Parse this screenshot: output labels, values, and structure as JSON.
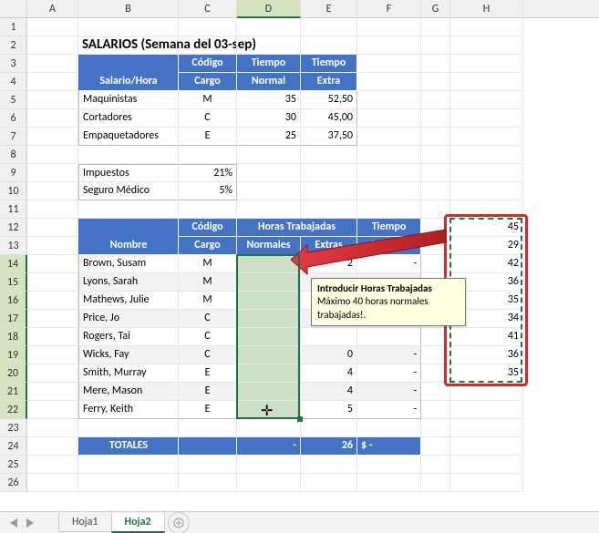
{
  "columns": [
    "A",
    "B",
    "C",
    "D",
    "E",
    "F",
    "G",
    "H"
  ],
  "rows": [
    "1",
    "2",
    "3",
    "4",
    "5",
    "6",
    "7",
    "8",
    "9",
    "10",
    "11",
    "12",
    "13",
    "14",
    "15",
    "16",
    "17",
    "18",
    "19",
    "20",
    "21",
    "22",
    "23",
    "24",
    "25",
    "26"
  ],
  "colWidths": {
    "A": 56,
    "B": 110,
    "C": 64,
    "D": 70,
    "E": 62,
    "F": 70,
    "G": 32,
    "H": 80
  },
  "title": "SALARIOS (Semana del 03-sep)",
  "table1": {
    "headers": {
      "salario_hora": "Salario/Hora",
      "codigo": "Código",
      "cargo": "Cargo",
      "tiempo": "Tiempo",
      "normal": "Normal",
      "extra": "Extra"
    },
    "rows": [
      {
        "nombre": "Maquinistas",
        "codigo": "M",
        "normal": "35",
        "extra": "52,50"
      },
      {
        "nombre": "Cortadores",
        "codigo": "C",
        "normal": "30",
        "extra": "45,00"
      },
      {
        "nombre": "Empaquetadores",
        "codigo": "E",
        "normal": "25",
        "extra": "37,50"
      }
    ]
  },
  "tax_rows": [
    {
      "label": "Impuestos",
      "value": "21%"
    },
    {
      "label": "Seguro Médico",
      "value": "5%"
    }
  ],
  "table2": {
    "headers": {
      "nombre": "Nombre",
      "codigo": "Código",
      "cargo": "Cargo",
      "horas": "Horas Trabajadas",
      "normales": "Normales",
      "extras": "Extras",
      "tiempo": "Tiempo",
      "tiempo2": "Normal"
    },
    "rows": [
      {
        "nombre": "Brown, Susam",
        "codigo": "M",
        "normales": "",
        "extras": "2",
        "tiempo": "-"
      },
      {
        "nombre": "Lyons, Sarah",
        "codigo": "M",
        "normales": "",
        "extras": "",
        "tiempo": ""
      },
      {
        "nombre": "Mathews, Julie",
        "codigo": "M",
        "normales": "",
        "extras": "",
        "tiempo": ""
      },
      {
        "nombre": "Price, Jo",
        "codigo": "C",
        "normales": "",
        "extras": "",
        "tiempo": ""
      },
      {
        "nombre": "Rogers, Tai",
        "codigo": "C",
        "normales": "",
        "extras": "",
        "tiempo": ""
      },
      {
        "nombre": "Wicks, Fay",
        "codigo": "C",
        "normales": "",
        "extras": "0",
        "tiempo": "-"
      },
      {
        "nombre": "Smith, Murray",
        "codigo": "E",
        "normales": "",
        "extras": "4",
        "tiempo": "-"
      },
      {
        "nombre": "Mere, Mason",
        "codigo": "E",
        "normales": "",
        "extras": "4",
        "tiempo": "-"
      },
      {
        "nombre": "Ferry, Keith",
        "codigo": "E",
        "normales": "",
        "extras": "5",
        "tiempo": "-"
      }
    ],
    "totales": {
      "label": "TOTALES",
      "d": "-",
      "e": "26",
      "f": "$            -"
    }
  },
  "colH": [
    "45",
    "29",
    "42",
    "36",
    "35",
    "34",
    "41",
    "36",
    "35"
  ],
  "tooltip": {
    "title": "Introducir Horas Trabajadas",
    "body": "Máximo 40 horas normales trabajadas!."
  },
  "cursor": "✛",
  "tabs": {
    "sheets": [
      "Hoja1",
      "Hoja2"
    ],
    "active": 1,
    "new": "+"
  },
  "chart_data": null
}
